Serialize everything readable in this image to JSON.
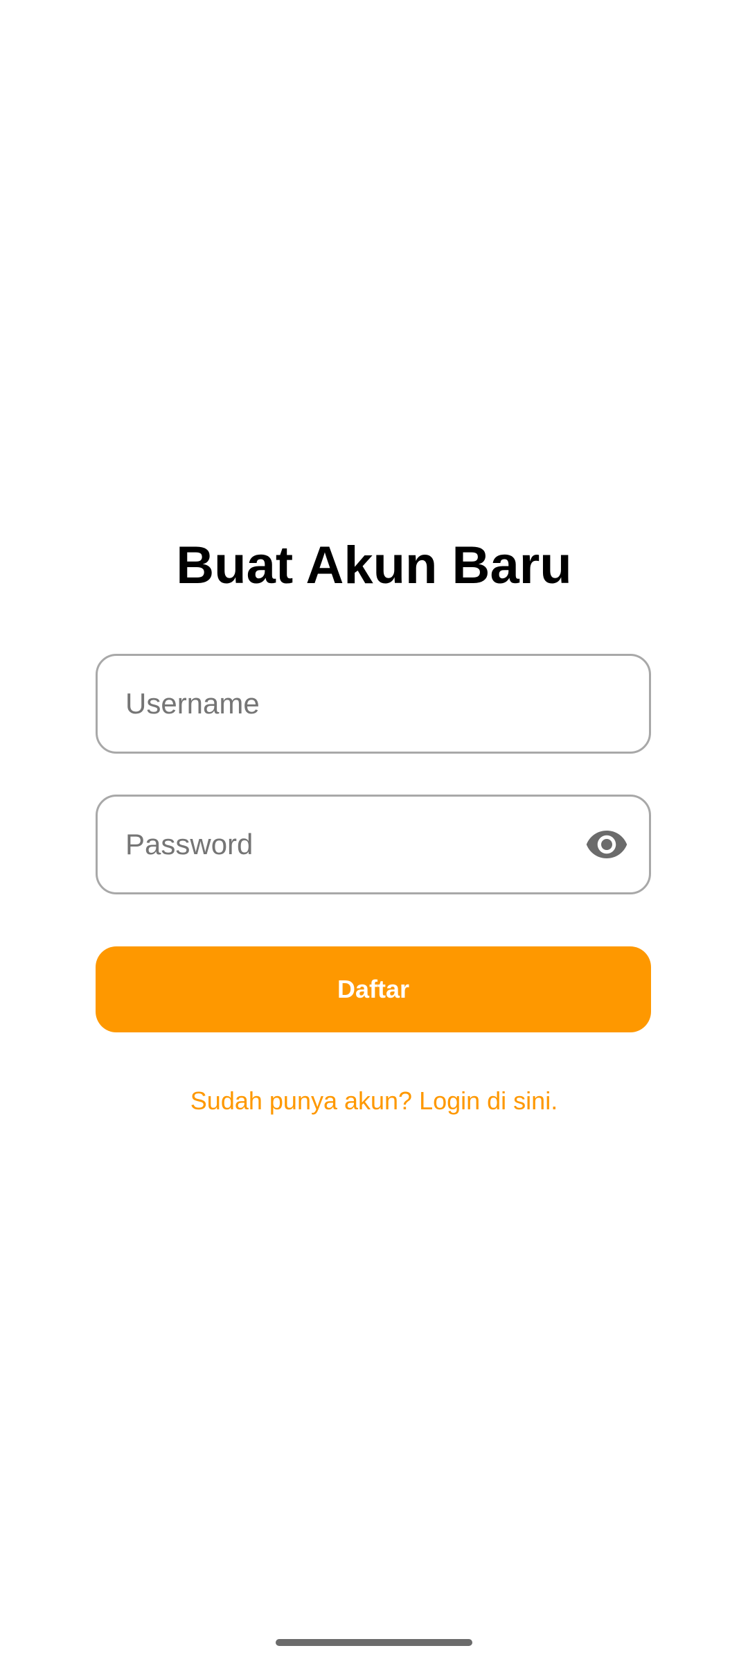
{
  "page": {
    "title": "Buat Akun Baru"
  },
  "form": {
    "username": {
      "value": "",
      "placeholder": "Username"
    },
    "password": {
      "value": "",
      "placeholder": "Password",
      "toggle_icon": "eye-icon"
    },
    "submit_label": "Daftar",
    "login_link": "Sudah punya akun? Login di sini."
  },
  "colors": {
    "accent": "#FE9800",
    "field_border": "#A8A8A8",
    "placeholder": "#757575",
    "background": "#FFFFFF"
  }
}
